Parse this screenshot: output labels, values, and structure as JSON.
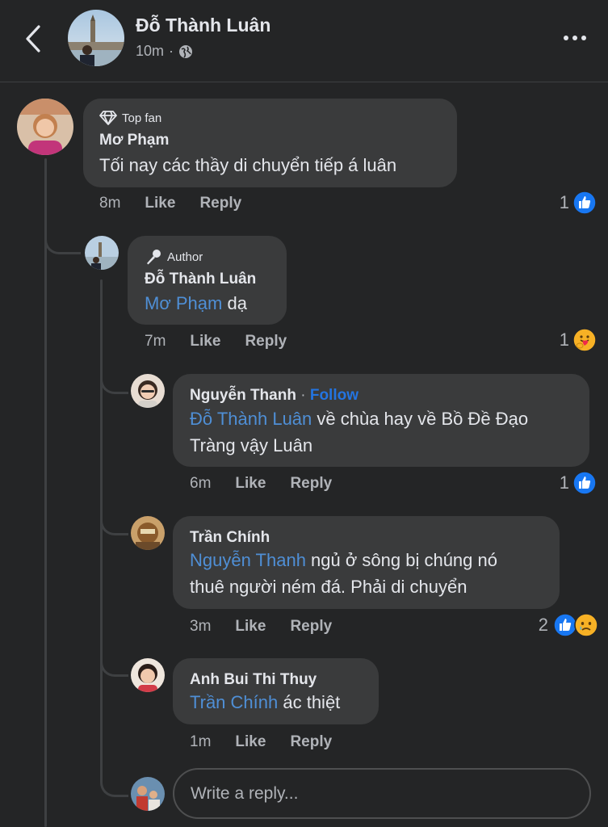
{
  "header": {
    "author_name": "Đỗ Thành Luân",
    "time": "10m",
    "separator": "·"
  },
  "comments": [
    {
      "badge": "Top fan",
      "name": "Mơ Phạm",
      "text": "Tối nay các thầy di chuyển tiếp á luân",
      "time": "8m",
      "like_label": "Like",
      "reply_label": "Reply",
      "reaction_count": "1",
      "reactions": [
        "like-icon"
      ]
    },
    {
      "badge": "Author",
      "name": "Đỗ Thành Luân",
      "mention": "Mơ Phạm",
      "text": " dạ",
      "time": "7m",
      "like_label": "Like",
      "reply_label": "Reply",
      "reaction_count": "1",
      "reactions": [
        "care-icon"
      ]
    },
    {
      "name": "Nguyễn Thanh",
      "follow_sep": " · ",
      "follow_label": "Follow",
      "mention": "Đỗ Thành Luân",
      "text_line1": " về chùa hay về Bồ Đề Đạo",
      "text_line2": "Tràng vậy Luân",
      "time": "6m",
      "like_label": "Like",
      "reply_label": "Reply",
      "reaction_count": "1",
      "reactions": [
        "like-icon"
      ]
    },
    {
      "name": "Trần Chính",
      "mention": "Nguyễn Thanh",
      "text_line1": " ngủ ở sông bị chúng nó",
      "text_line2": "thuê người ném đá. Phải di chuyển",
      "time": "3m",
      "like_label": "Like",
      "reply_label": "Reply",
      "reaction_count": "2",
      "reactions": [
        "like-icon",
        "sad-icon"
      ]
    },
    {
      "name": "Anh Bui Thi Thuy",
      "mention": "Trần Chính",
      "text": " ác thiệt",
      "time": "1m",
      "like_label": "Like",
      "reply_label": "Reply"
    }
  ],
  "reply_box": {
    "placeholder": "Write a reply..."
  },
  "colors": {
    "background": "#242526",
    "bubble": "#3a3b3c",
    "mention": "#4f8fd6",
    "follow": "#2374e1",
    "like_blue": "#1877f2"
  }
}
